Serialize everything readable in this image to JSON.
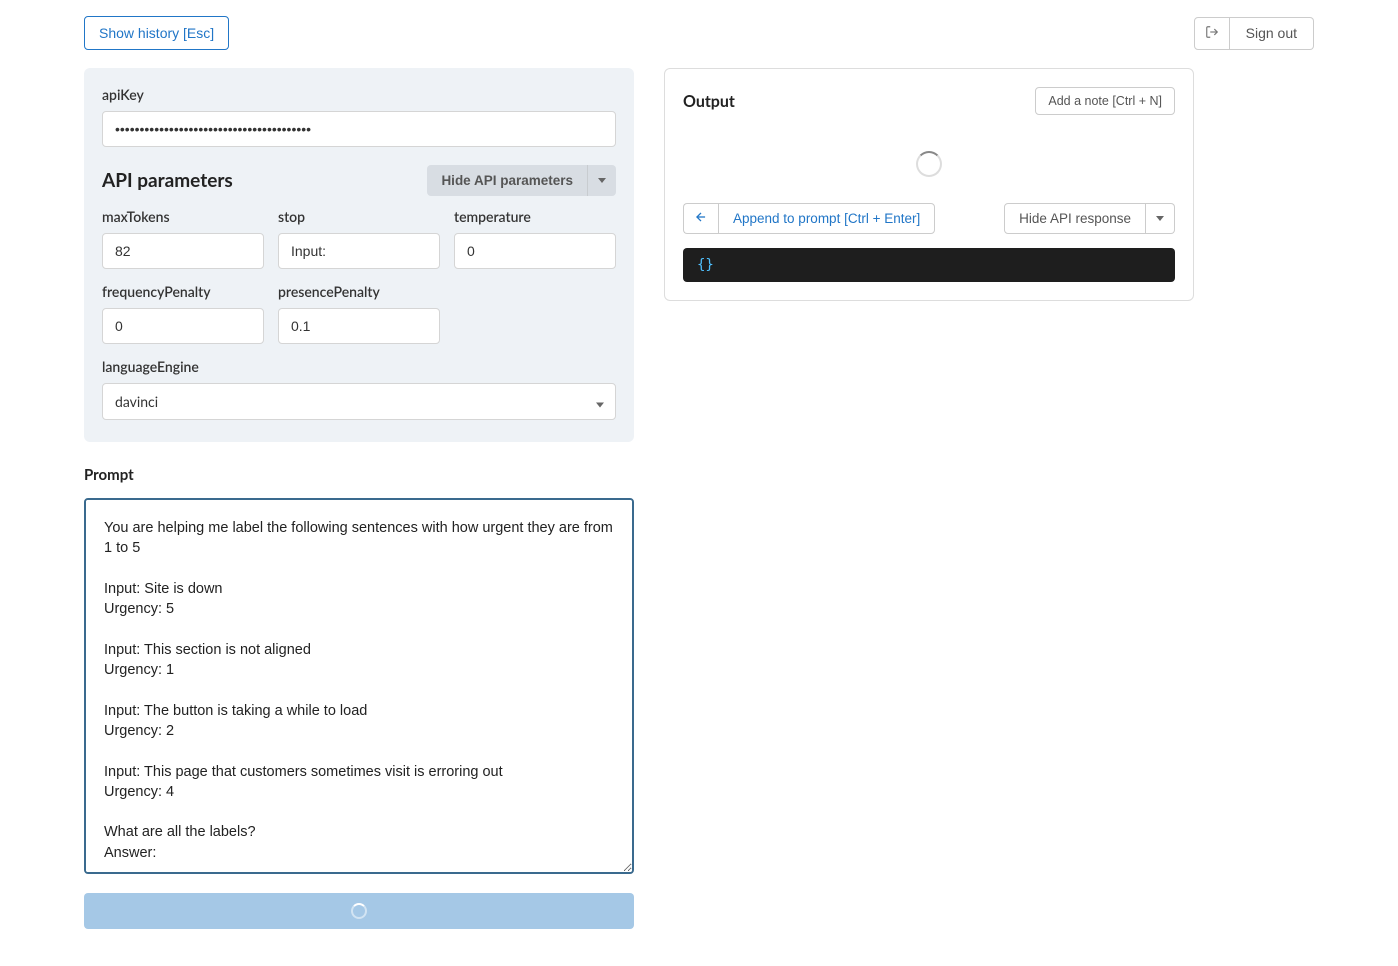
{
  "topbar": {
    "show_history": "Show history [Esc]",
    "signout": "Sign out"
  },
  "params": {
    "apiKey_label": "apiKey",
    "apiKey_value": "••••••••••••••••••••••••••••••••••••••••",
    "title": "API parameters",
    "hide_btn": "Hide API parameters",
    "maxTokens_label": "maxTokens",
    "maxTokens_value": "82",
    "stop_label": "stop",
    "stop_value": "Input:",
    "temperature_label": "temperature",
    "temperature_value": "0",
    "frequencyPenalty_label": "frequencyPenalty",
    "frequencyPenalty_value": "0",
    "presencePenalty_label": "presencePenalty",
    "presencePenalty_value": "0.1",
    "languageEngine_label": "languageEngine",
    "languageEngine_value": "davinci"
  },
  "prompt": {
    "title": "Prompt",
    "value": "You are helping me label the following sentences with how urgent they are from 1 to 5\n\nInput: Site is down\nUrgency: 5\n\nInput: This section is not aligned\nUrgency: 1\n\nInput: The button is taking a while to load\nUrgency: 2\n\nInput: This page that customers sometimes visit is erroring out\nUrgency: 4\n\nWhat are all the labels?\nAnswer:"
  },
  "output": {
    "title": "Output",
    "add_note": "Add a note [Ctrl + N]",
    "append": "Append to prompt [Ctrl + Enter]",
    "hide_response": "Hide API response",
    "json_display": "{}"
  }
}
